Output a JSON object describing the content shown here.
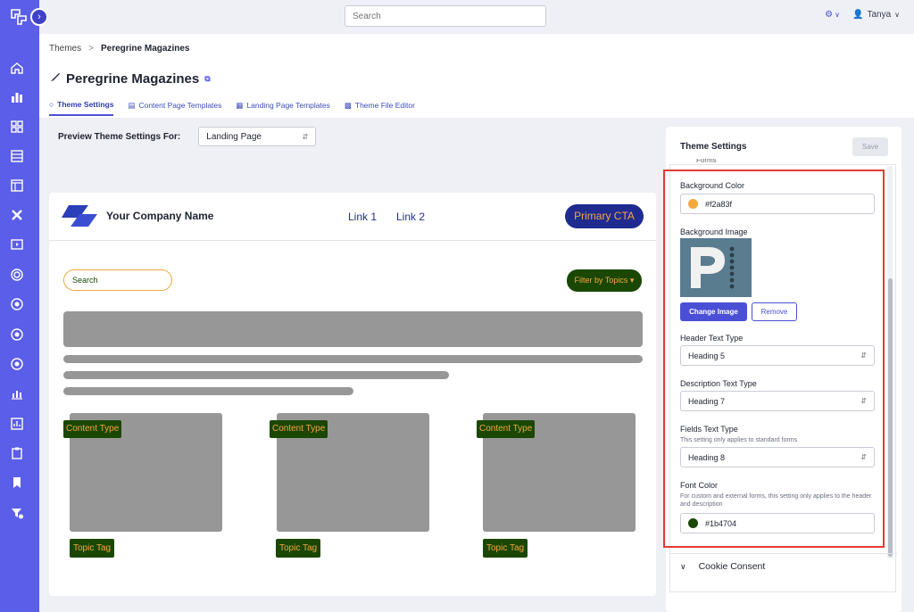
{
  "topbar": {
    "search_placeholder": "Search",
    "user_name": "Tanya"
  },
  "breadcrumb": {
    "parent": "Themes",
    "separator": ">",
    "current": "Peregrine Magazines"
  },
  "page": {
    "title": "Peregrine Magazines"
  },
  "tabs": [
    {
      "label": "Theme Settings",
      "icon": "theme-icon",
      "active": true
    },
    {
      "label": "Content Page Templates",
      "icon": "template-icon",
      "active": false
    },
    {
      "label": "Landing Page Templates",
      "icon": "doc-icon",
      "active": false
    },
    {
      "label": "Theme File Editor",
      "icon": "file-editor-icon",
      "active": false
    }
  ],
  "preview": {
    "label": "Preview Theme Settings For:",
    "selected": "Landing Page"
  },
  "canvas": {
    "company": "Your Company Name",
    "link1": "Link 1",
    "link2": "Link 2",
    "cta": "Primary CTA",
    "search": "Search",
    "filter": "Filter by Topics",
    "content_type": "Content Type",
    "topic_tag": "Topic Tag"
  },
  "panel": {
    "title": "Theme Settings",
    "save": "Save",
    "cut_label": "Forms",
    "bg_color_label": "Background Color",
    "bg_color_value": "#f2a83f",
    "bg_image_label": "Background Image",
    "change_image": "Change Image",
    "remove": "Remove",
    "header_text_label": "Header Text Type",
    "header_text_value": "Heading 5",
    "desc_text_label": "Description Text Type",
    "desc_text_value": "Heading 7",
    "fields_text_label": "Fields Text Type",
    "fields_text_help": "This setting only applies to standard forms",
    "fields_text_value": "Heading 8",
    "font_color_label": "Font Color",
    "font_color_help": "For custom and external forms, this setting only applies to the header and description",
    "font_color_value": "#1b4704",
    "cookie_consent": "Cookie Consent"
  },
  "colors": {
    "rail": "#5b5ee8",
    "accent": "#4b4fd6",
    "cta_bg": "#1f2b8f",
    "bg_color": "#f2a83f",
    "font_color": "#1b4704",
    "highlight": "#e53935"
  }
}
